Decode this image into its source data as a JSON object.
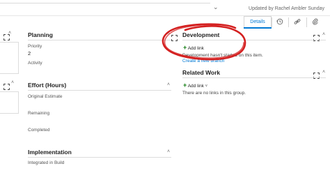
{
  "header": {
    "updated_text": "Updated by Rachel Ambler Sunday"
  },
  "tabs": {
    "details_label": "Details",
    "history_icon": "history-icon",
    "link_icon": "link-icon",
    "attachment_icon": "attachment-icon"
  },
  "planning": {
    "title": "Planning",
    "priority_label": "Priority",
    "priority_value": "2",
    "activity_label": "Activity"
  },
  "effort": {
    "title": "Effort (Hours)",
    "original_estimate_label": "Original Estimate",
    "remaining_label": "Remaining",
    "completed_label": "Completed"
  },
  "implementation": {
    "title": "Implementation",
    "integrated_label": "Integrated in Build"
  },
  "development": {
    "title": "Development",
    "add_link": "Add link",
    "note": "Development hasn't started on this item.",
    "create_branch": "Create a new branch"
  },
  "related_work": {
    "title": "Related Work",
    "add_link": "Add link",
    "empty_note": "There are no links in this group."
  },
  "colors": {
    "accent": "#0078d4",
    "annotation": "#d42020",
    "add_plus": "#107c10"
  }
}
